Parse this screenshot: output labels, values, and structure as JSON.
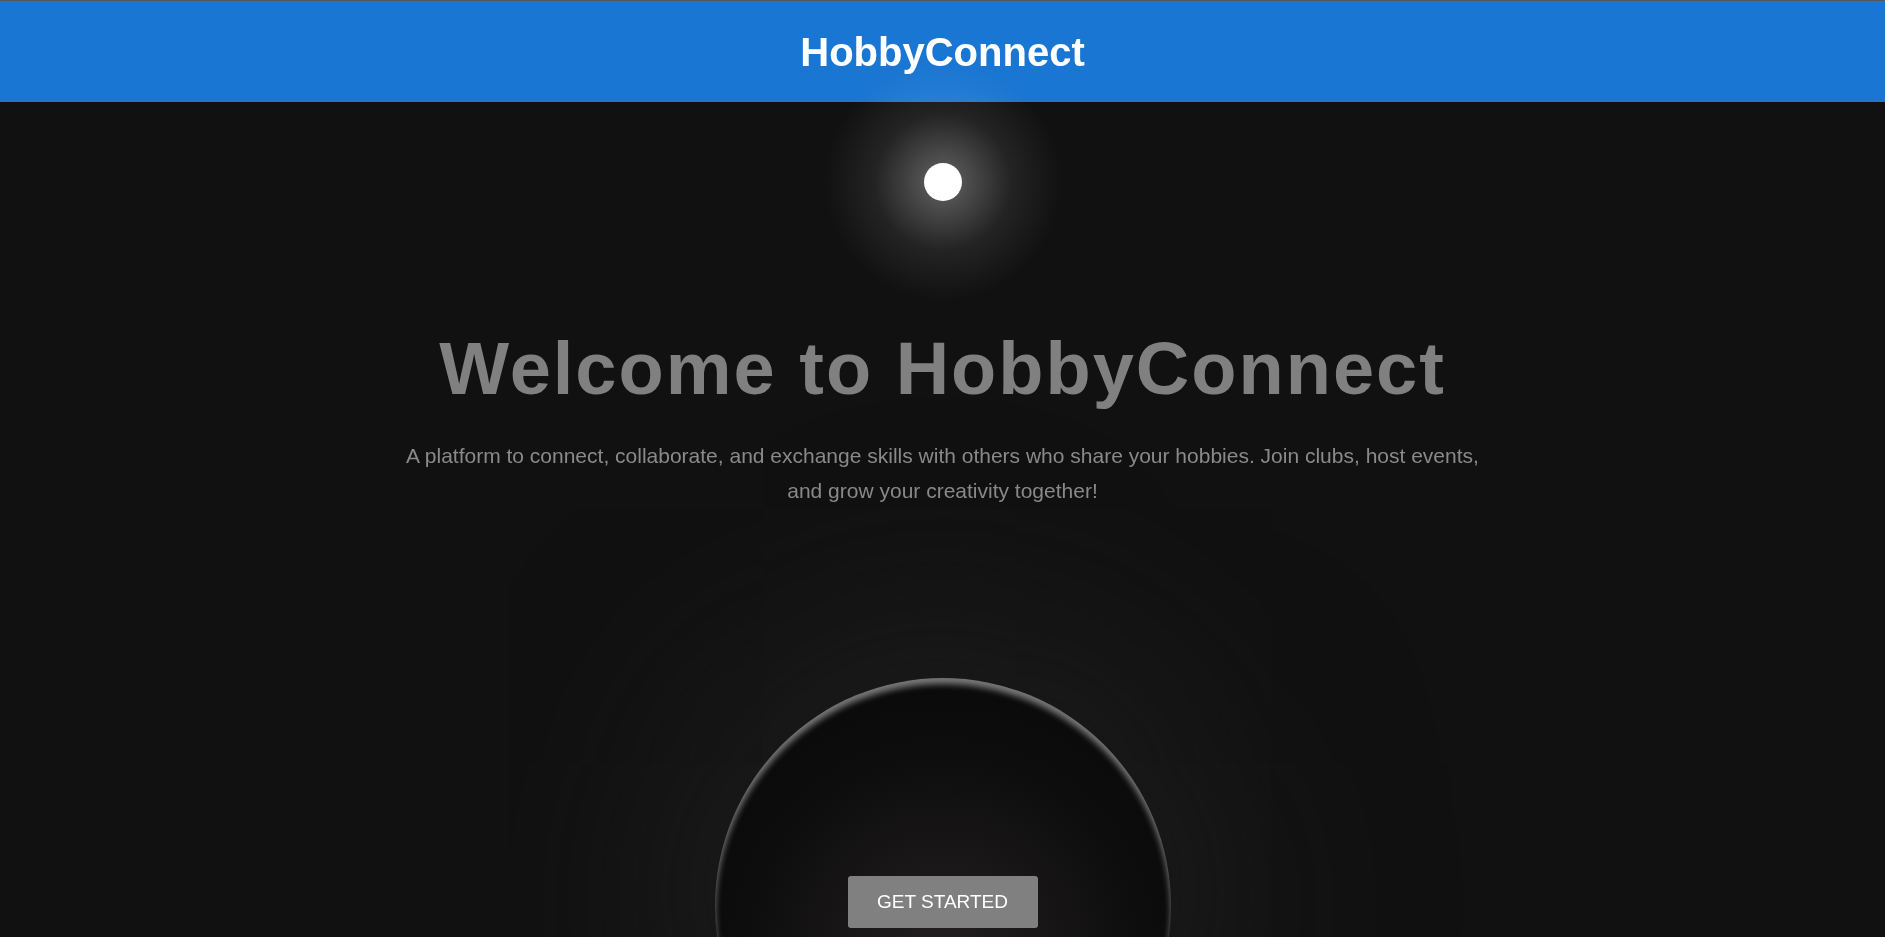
{
  "header": {
    "title": "HobbyConnect"
  },
  "hero": {
    "heading": "Welcome to HobbyConnect",
    "description": "A platform to connect, collaborate, and exchange skills with others who share your hobbies. Join clubs, host events, and grow your creativity together!",
    "button": "GET STARTED"
  }
}
